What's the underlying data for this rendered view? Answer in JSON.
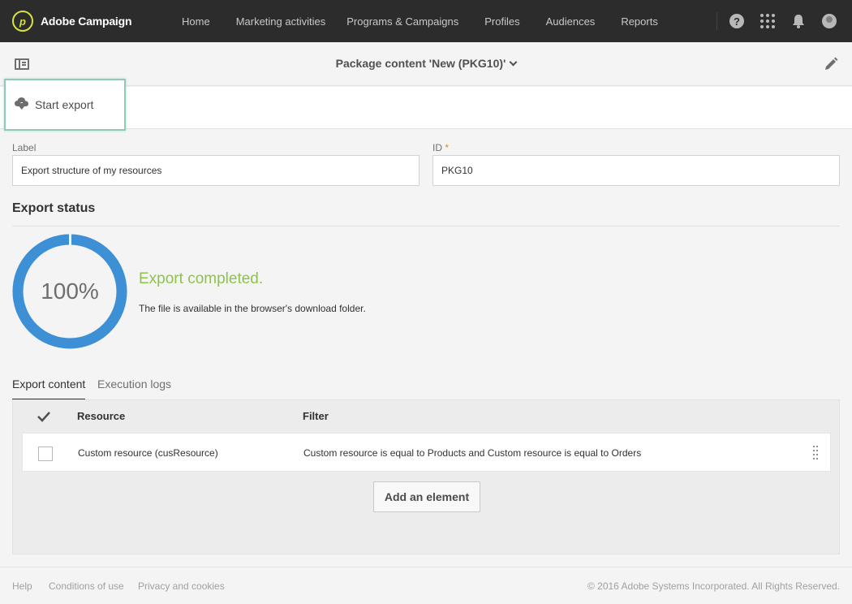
{
  "app": {
    "brand_name": "Adobe Campaign",
    "brand_logo_glyph": "p",
    "brand_color": "#d8e23a"
  },
  "nav": {
    "items": [
      {
        "label": "Home"
      },
      {
        "label": "Marketing activities"
      },
      {
        "label": "Programs & Campaigns"
      },
      {
        "label": "Profiles"
      },
      {
        "label": "Audiences"
      },
      {
        "label": "Reports"
      }
    ],
    "icons": [
      "help-icon",
      "apps-grid-icon",
      "notification-bell-icon",
      "user-avatar-icon"
    ],
    "help_glyph": "?"
  },
  "header": {
    "title": "Package content 'New (PKG10)'",
    "icons": [
      "sidebar-toggle-icon",
      "chevron-down-icon",
      "edit-pencil-icon"
    ]
  },
  "actions": {
    "start_export_label": "Start export",
    "start_export_icon": "cloud-download-icon",
    "highlight_color": "#8fcbb4"
  },
  "form": {
    "label_title": "Label",
    "label_value": "Export structure of my resources",
    "id_title": "ID",
    "id_required_marker": "*",
    "id_value": "PKG10"
  },
  "export_status": {
    "section_title": "Export status",
    "progress_percent": 100,
    "progress_text": "100%",
    "status_title": "Export completed.",
    "status_description": "The file is available in the browser's download folder.",
    "progress_color": "#3d8fd6",
    "status_color": "#8dc44a"
  },
  "tabs": [
    {
      "label": "Export content",
      "active": true
    },
    {
      "label": "Execution logs",
      "active": false
    }
  ],
  "table": {
    "columns": {
      "resource": "Resource",
      "filter": "Filter"
    },
    "rows": [
      {
        "resource": "Custom resource (cusResource)",
        "filter": "Custom resource is equal to Products and Custom resource is equal to Orders",
        "checked": false
      }
    ],
    "add_button_label": "Add an element"
  },
  "footer": {
    "links": [
      {
        "label": "Help"
      },
      {
        "label": "Conditions of use"
      },
      {
        "label": "Privacy and cookies"
      }
    ],
    "copyright": "© 2016 Adobe Systems Incorporated. All Rights Reserved."
  }
}
